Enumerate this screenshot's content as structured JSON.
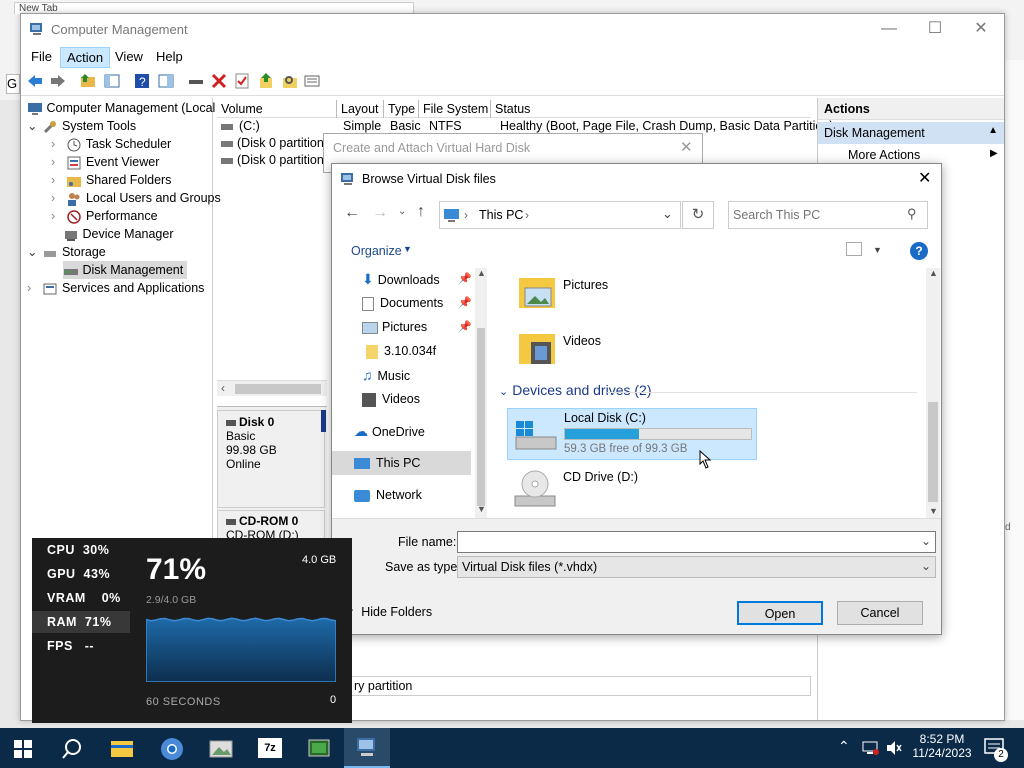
{
  "background_window": {
    "tab_text": "New Tab",
    "side_text": "d"
  },
  "computer_management": {
    "title": "Computer Management",
    "menu": [
      "File",
      "Action",
      "View",
      "Help"
    ],
    "tree": [
      {
        "label": "Computer Management (Local",
        "level": 0
      },
      {
        "label": "System Tools",
        "level": 1
      },
      {
        "label": "Task Scheduler",
        "level": 2
      },
      {
        "label": "Event Viewer",
        "level": 2
      },
      {
        "label": "Shared Folders",
        "level": 2
      },
      {
        "label": "Local Users and Groups",
        "level": 2
      },
      {
        "label": "Performance",
        "level": 2
      },
      {
        "label": "Device Manager",
        "level": 2
      },
      {
        "label": "Storage",
        "level": 1
      },
      {
        "label": "Disk Management",
        "level": 2
      },
      {
        "label": "Services and Applications",
        "level": 1
      }
    ],
    "volume_columns": [
      "Volume",
      "Layout",
      "Type",
      "File System",
      "Status"
    ],
    "volume_rows": [
      {
        "volume": "(C:)",
        "layout": "Simple",
        "type": "Basic",
        "fs": "NTFS",
        "status": "Healthy (Boot, Page File, Crash Dump, Basic Data Partition)"
      },
      {
        "volume": "(Disk 0 partition",
        "layout": "",
        "type": "",
        "fs": "",
        "status": ""
      },
      {
        "volume": "(Disk 0 partition",
        "layout": "",
        "type": "",
        "fs": "",
        "status": ""
      }
    ],
    "disk0": {
      "name": "Disk 0",
      "type": "Basic",
      "size": "99.98 GB",
      "state": "Online"
    },
    "cdrom": {
      "name": "CD-ROM 0",
      "sub": "CD-ROM (D:)"
    },
    "partition_label": "ry partition",
    "actions": {
      "header": "Actions",
      "section": "Disk Management",
      "more": "More Actions"
    }
  },
  "vhd_dialog": {
    "title": "Create and Attach Virtual Hard Disk"
  },
  "browse": {
    "title": "Browse Virtual Disk files",
    "address": "This PC",
    "search_placeholder": "Search This PC",
    "organize": "Organize",
    "nav": [
      "Downloads",
      "Documents",
      "Pictures",
      "3.10.034f",
      "Music",
      "Videos",
      "OneDrive",
      "This PC",
      "Network"
    ],
    "folders": [
      "Pictures",
      "Videos"
    ],
    "devices_header": "Devices and drives (2)",
    "drives": [
      {
        "name": "Local Disk (C:)",
        "free": "59.3 GB free of 99.3 GB",
        "used_fraction": 0.4
      },
      {
        "name": "CD Drive (D:)"
      }
    ],
    "file_name_label": "File name:",
    "file_name_value": "",
    "save_type_label": "Save as type:",
    "save_type_value": "Virtual Disk files (*.vhdx)",
    "hide_folders": "Hide Folders",
    "open": "Open",
    "cancel": "Cancel"
  },
  "perf": {
    "rows": [
      {
        "label": "CPU",
        "value": "30%"
      },
      {
        "label": "GPU",
        "value": "43%"
      },
      {
        "label": "VRAM",
        "value": "0%"
      },
      {
        "label": "RAM",
        "value": "71%"
      },
      {
        "label": "FPS",
        "value": "--"
      }
    ],
    "big": "71%",
    "max": "4.0 GB",
    "used": "2.9/4.0 GB",
    "duration": "60 SECONDS",
    "zero": "0",
    "graph_fraction": 0.71
  },
  "taskbar": {
    "time": "8:52 PM",
    "date": "11/24/2023",
    "notif_count": "2"
  }
}
